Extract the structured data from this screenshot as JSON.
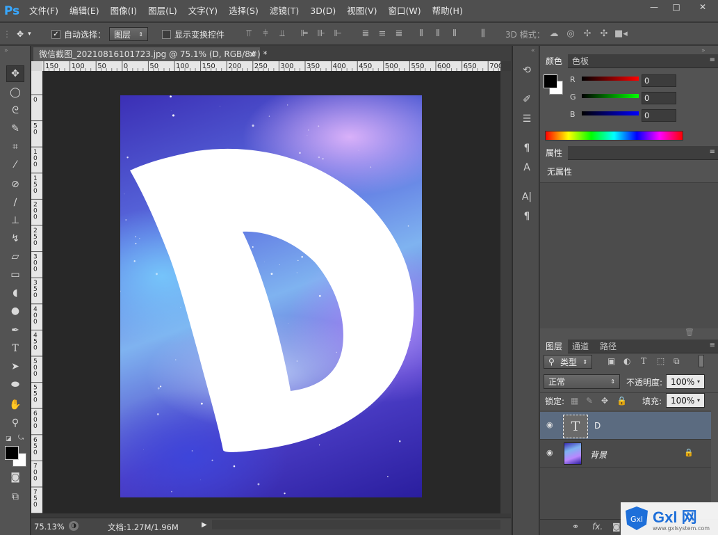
{
  "app": {
    "logo": "Ps"
  },
  "menu": [
    "文件(F)",
    "编辑(E)",
    "图像(I)",
    "图层(L)",
    "文字(Y)",
    "选择(S)",
    "滤镜(T)",
    "3D(D)",
    "视图(V)",
    "窗口(W)",
    "帮助(H)"
  ],
  "window_controls": {
    "minimize": "—",
    "maximize": "□",
    "close": "✕"
  },
  "options": {
    "auto_select_label": "自动选择：",
    "auto_select_checked": "✓",
    "auto_select_target": "图层",
    "show_transform_label": "显示变换控件",
    "mode_3d_label": "3D 模式："
  },
  "document": {
    "tab_title": "微信截图_20210816101723.jpg @ 75.1% (D, RGB/8#) *",
    "tab_close": "×",
    "canvas_text": "D"
  },
  "ruler": {
    "h_ticks": [
      "150",
      "100",
      "50",
      "0",
      "50",
      "100",
      "150",
      "200",
      "250",
      "300",
      "350",
      "400",
      "450",
      "500",
      "550",
      "600",
      "650",
      "700"
    ],
    "v_ticks": [
      "0",
      "5 0",
      "1 0 0",
      "1 5 0",
      "2 0 0",
      "2 5 0",
      "3 0 0",
      "3 5 0",
      "4 0 0",
      "4 5 0",
      "5 0 0",
      "5 5 0",
      "6 0 0",
      "6 5 0",
      "7 0 0",
      "7 5 0",
      "8 0 0"
    ]
  },
  "status": {
    "zoom": "75.13%",
    "doc_info": "文档:1.27M/1.96M"
  },
  "color_panel": {
    "tabs": [
      "颜色",
      "色板"
    ],
    "channels": [
      {
        "name": "R",
        "value": "0"
      },
      {
        "name": "G",
        "value": "0"
      },
      {
        "name": "B",
        "value": "0"
      }
    ]
  },
  "properties_panel": {
    "tab": "属性",
    "empty_text": "无属性"
  },
  "layers_panel": {
    "tabs": [
      "图层",
      "通道",
      "路径"
    ],
    "filter_kind": "类型",
    "blend_mode": "正常",
    "opacity_label": "不透明度:",
    "opacity_value": "100%",
    "lock_label": "锁定:",
    "fill_label": "填充:",
    "fill_value": "100%",
    "layers": [
      {
        "name": "D",
        "type": "text",
        "selected": true
      },
      {
        "name": "背景",
        "type": "image",
        "locked": true
      }
    ]
  },
  "watermark": {
    "text": "Gxl 网",
    "url": "www.gxlsystem.com"
  },
  "colors": {
    "accent": "#38a8ff",
    "selected_layer": "#5b6b80",
    "fg": "#000000",
    "bg": "#ffffff"
  }
}
